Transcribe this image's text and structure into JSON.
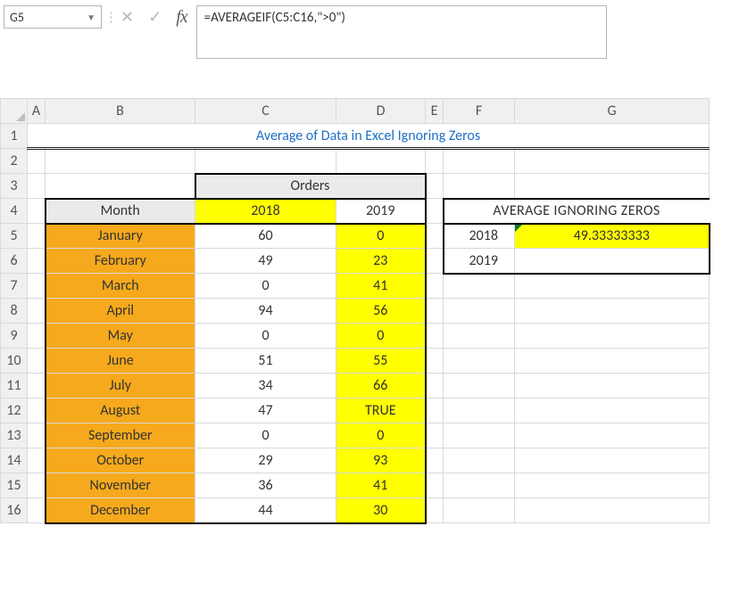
{
  "formula_bar": {
    "cell_ref": "G5",
    "formula": "=AVERAGEIF(C5:C16,\">0\")"
  },
  "columns": {
    "A": "A",
    "B": "B",
    "C": "C",
    "D": "D",
    "E": "E",
    "F": "F",
    "G": "G"
  },
  "rows": [
    "1",
    "2",
    "3",
    "4",
    "5",
    "6",
    "7",
    "8",
    "9",
    "10",
    "11",
    "12",
    "13",
    "14",
    "15",
    "16"
  ],
  "title": "Average of Data in Excel Ignoring Zeros",
  "orders_header": "Orders",
  "month_header": "Month",
  "year_2018": "2018",
  "year_2019": "2019",
  "months": {
    "jan": "January",
    "feb": "February",
    "mar": "March",
    "apr": "April",
    "may": "May",
    "jun": "June",
    "jul": "July",
    "aug": "August",
    "sep": "September",
    "oct": "October",
    "nov": "November",
    "dec": "December"
  },
  "data_2018": {
    "jan": "60",
    "feb": "49",
    "mar": "0",
    "apr": "94",
    "may": "0",
    "jun": "51",
    "jul": "34",
    "aug": "47",
    "sep": "0",
    "oct": "29",
    "nov": "36",
    "dec": "44"
  },
  "data_2019": {
    "jan": "0",
    "feb": "23",
    "mar": "41",
    "apr": "56",
    "may": "0",
    "jun": "55",
    "jul": "66",
    "aug": "TRUE",
    "sep": "0",
    "oct": "93",
    "nov": "41",
    "dec": "30"
  },
  "avg_box": {
    "header": "AVERAGE IGNORING ZEROS",
    "label_2018": "2018",
    "label_2019": "2019",
    "value_2018": "49.33333333",
    "value_2019": ""
  },
  "chart_data": {
    "type": "table",
    "title": "Average of Data in Excel Ignoring Zeros",
    "categories": [
      "January",
      "February",
      "March",
      "April",
      "May",
      "June",
      "July",
      "August",
      "September",
      "October",
      "November",
      "December"
    ],
    "series": [
      {
        "name": "2018",
        "values": [
          60,
          49,
          0,
          94,
          0,
          51,
          34,
          47,
          0,
          29,
          36,
          44
        ]
      },
      {
        "name": "2019",
        "values": [
          0,
          23,
          41,
          56,
          0,
          55,
          66,
          "TRUE",
          0,
          93,
          41,
          30
        ]
      }
    ],
    "derived": {
      "average_ignoring_zeros_2018": 49.33333333
    }
  }
}
